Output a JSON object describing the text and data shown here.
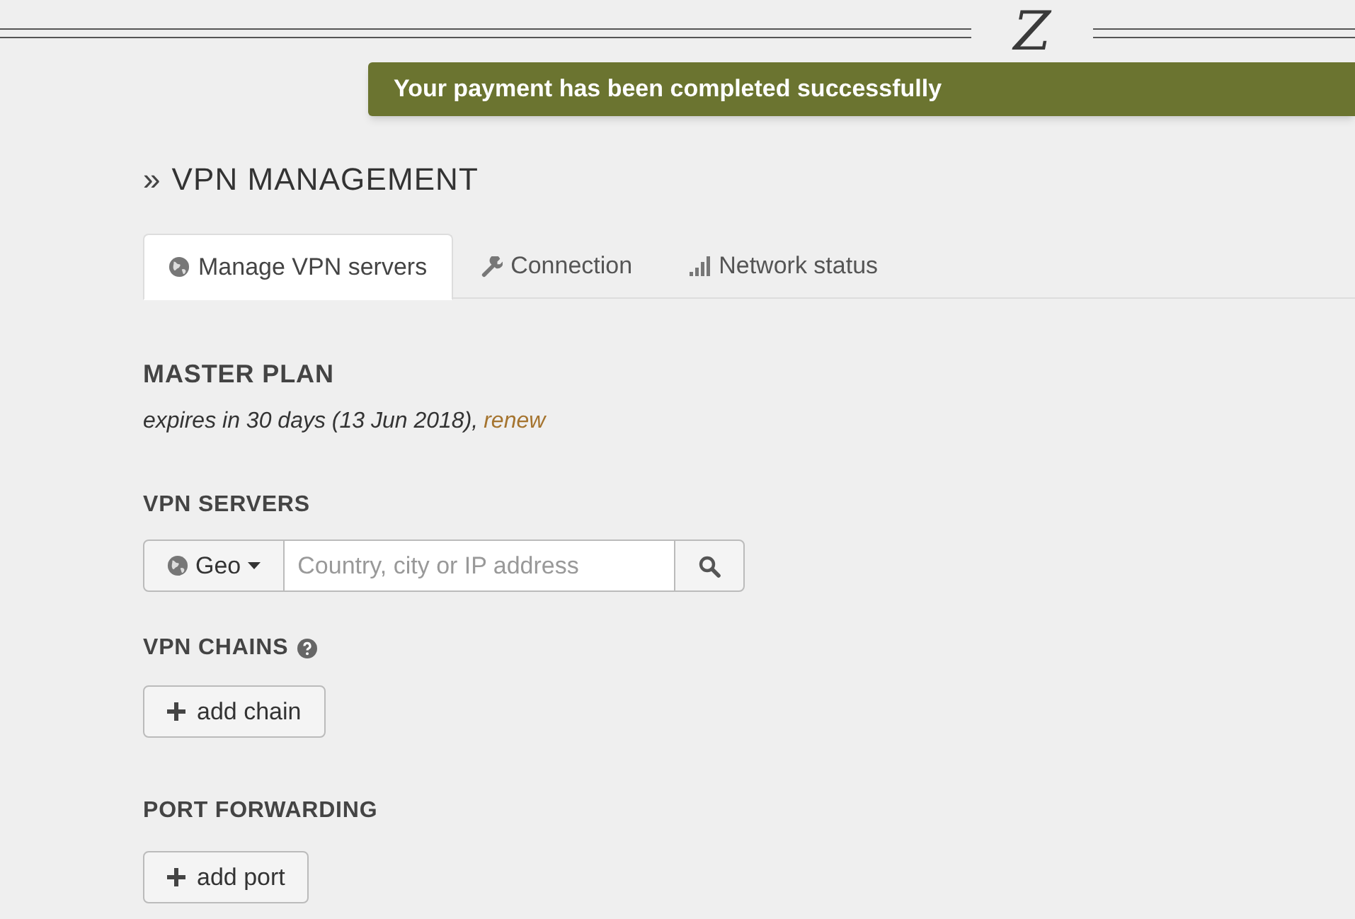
{
  "logo": "Z",
  "notification": {
    "text": "Your payment has been completed successfully"
  },
  "page_title": {
    "mark": "»",
    "text": "VPN MANAGEMENT"
  },
  "tabs": [
    {
      "label": "Manage VPN servers",
      "kind": "globe",
      "selected": true
    },
    {
      "label": "Connection",
      "kind": "wrench",
      "selected": false
    },
    {
      "label": "Network status",
      "kind": "signal",
      "selected": false
    }
  ],
  "plan": {
    "title": "MASTER PLAN",
    "expiry": "expires in 30 days (13 Jun 2018),",
    "link": "renew"
  },
  "vpn_servers": {
    "title": "VPN SERVERS",
    "filter": "Geo",
    "placeholder": "Country, city or IP address"
  },
  "vpn_chains": {
    "title": "VPN CHAINS",
    "help": true,
    "button": "add chain"
  },
  "port_forwarding": {
    "title": "PORT FORWARDING",
    "button": "add port"
  }
}
